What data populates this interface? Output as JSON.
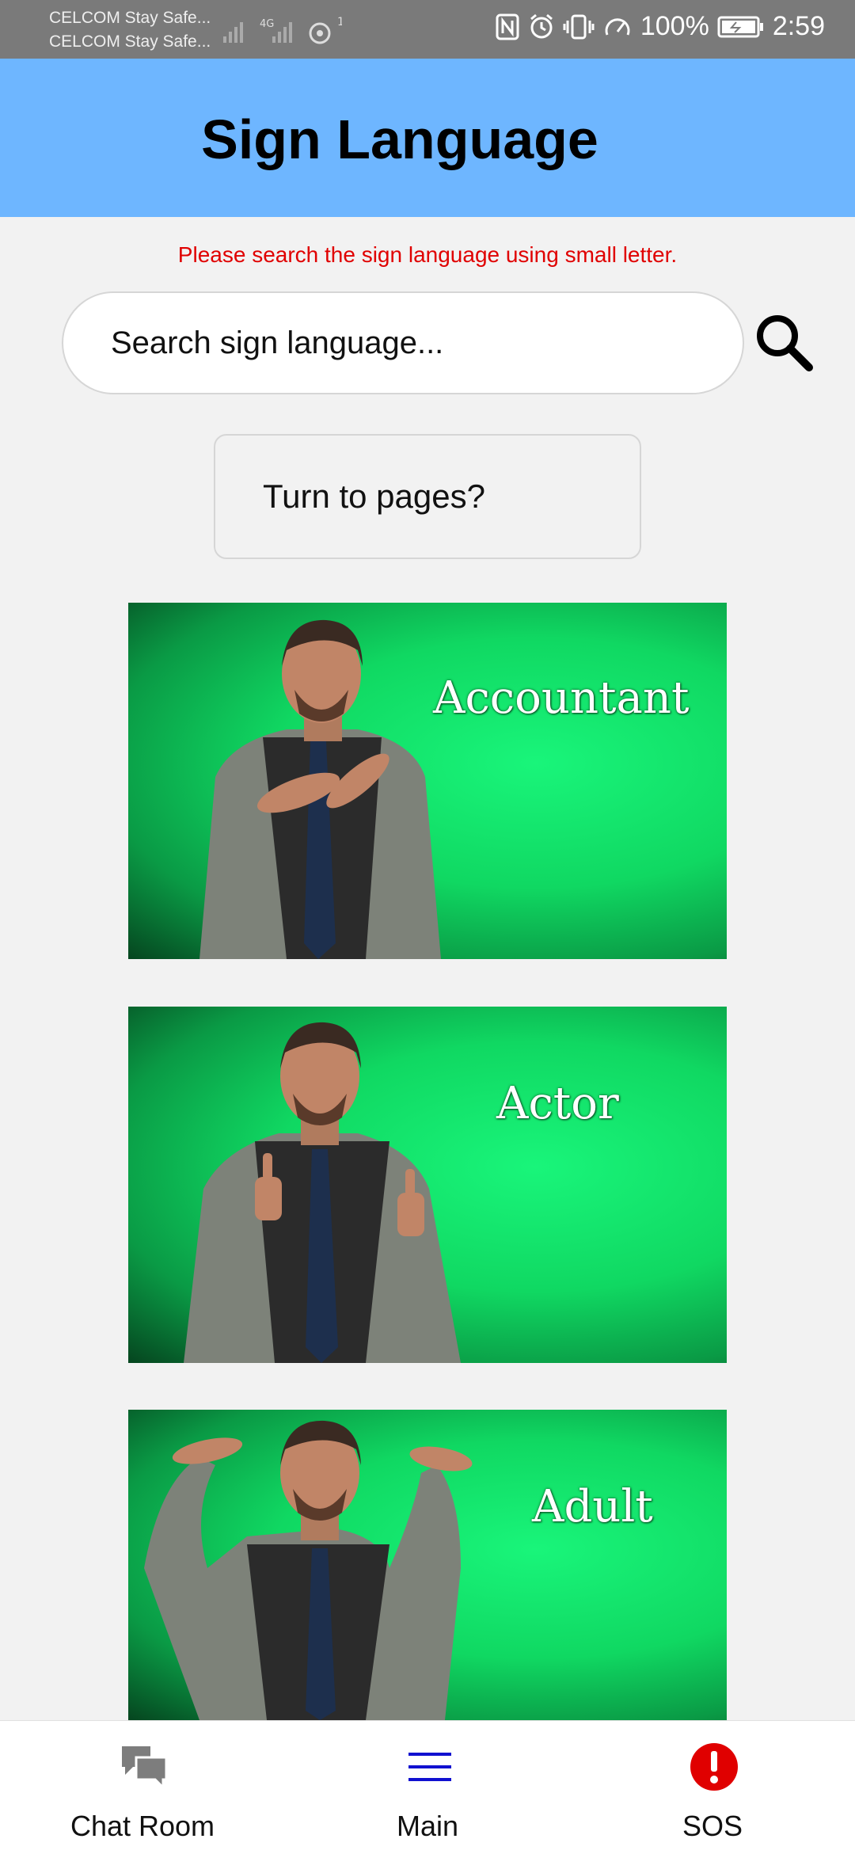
{
  "status_bar": {
    "carrier_1": "CELCOM Stay Safe...",
    "carrier_2": "CELCOM Stay Safe...",
    "network": "4G",
    "hotspot_count": "1",
    "battery": "100%",
    "time": "2:59"
  },
  "header": {
    "title": "Sign Language"
  },
  "hint": "Please search the sign language using small letter.",
  "search": {
    "placeholder": "Search sign language...",
    "icon": "search-icon"
  },
  "pages_button": {
    "label": "Turn to pages?"
  },
  "signs": [
    {
      "label": "Accountant"
    },
    {
      "label": "Actor"
    },
    {
      "label": "Adult"
    }
  ],
  "bottom_nav": {
    "items": [
      {
        "label": "Chat Room",
        "icon": "chat-icon",
        "color": "#7d7d7d"
      },
      {
        "label": "Main",
        "icon": "menu-icon",
        "color": "#1010d0"
      },
      {
        "label": "SOS",
        "icon": "alert-icon",
        "color": "#e00000"
      }
    ]
  },
  "colors": {
    "header_bg": "#6eb6ff",
    "hint_text": "#e00000",
    "card_green": "#10d862"
  }
}
